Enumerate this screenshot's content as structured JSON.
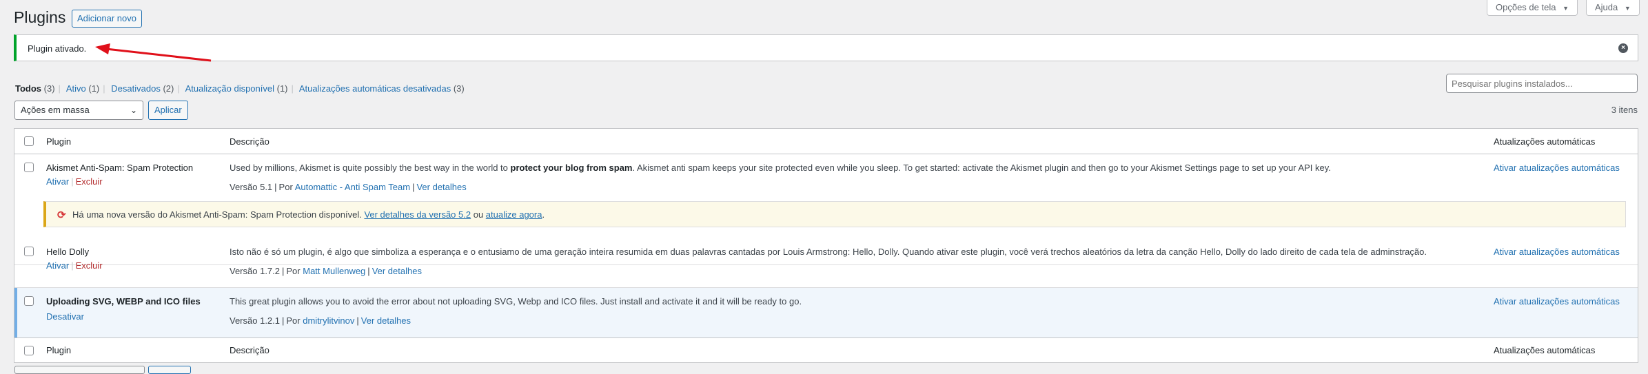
{
  "header": {
    "title": "Plugins",
    "add_new": "Adicionar novo",
    "screen_options": "Opções de tela",
    "help": "Ajuda"
  },
  "notice": {
    "text": "Plugin ativado."
  },
  "filters": [
    {
      "label": "Todos",
      "count": "(3)"
    },
    {
      "label": "Ativo",
      "count": "(1)"
    },
    {
      "label": "Desativados",
      "count": "(2)"
    },
    {
      "label": "Atualização disponível",
      "count": "(1)"
    },
    {
      "label": "Atualizações automáticas desativadas",
      "count": "(3)"
    }
  ],
  "search": {
    "placeholder": "Pesquisar plugins instalados..."
  },
  "bulk": {
    "selected": "Ações em massa",
    "apply": "Aplicar"
  },
  "items_count": "3 itens",
  "table": {
    "columns": {
      "plugin": "Plugin",
      "description": "Descrição",
      "auto": "Atualizações automáticas"
    },
    "sep": "|",
    "rows": [
      {
        "name": "Akismet Anti-Spam: Spam Protection",
        "action_1": "Ativar",
        "action_2": "Excluir",
        "desc_before": "Used by millions, Akismet is quite possibly the best way in the world to ",
        "desc_bold": "protect your blog from spam",
        "desc_after": ". Akismet anti spam keeps your site protected even while you sleep. To get started: activate the Akismet plugin and then go to your Akismet Settings page to set up your API key.",
        "version": "Versão 5.1",
        "by": "Por",
        "author": "Automattic - Anti Spam Team",
        "details": "Ver detalhes",
        "auto": "Ativar atualizações automáticas"
      },
      {
        "name": "Hello Dolly",
        "action_1": "Ativar",
        "action_2": "Excluir",
        "desc": "Isto não é só um plugin, é algo que simboliza a esperança e o entusiamo de uma geração inteira resumida em duas palavras cantadas por Louis Armstrong: Hello, Dolly. Quando ativar este plugin, você verá trechos aleatórios da letra da canção Hello, Dolly do lado direito de cada tela de adminstração.",
        "version": "Versão 1.7.2",
        "by": "Por",
        "author": "Matt Mullenweg",
        "details": "Ver detalhes",
        "auto": "Ativar atualizações automáticas"
      },
      {
        "name": "Uploading SVG, WEBP and ICO files",
        "action_1": "Desativar",
        "desc": "This great plugin allows you to avoid the error about not uploading SVG, Webp and ICO files. Just install and activate it and it will be ready to go.",
        "version": "Versão 1.2.1",
        "by": "Por",
        "author": "dmitrylitvinov",
        "details": "Ver detalhes",
        "auto": "Ativar atualizações automáticas"
      }
    ],
    "update_notice": {
      "before": "Há uma nova versão do Akismet Anti-Spam: Spam Protection disponível. ",
      "link_1": "Ver detalhes da versão 5.2",
      "middle": " ou ",
      "link_2": "atualize agora",
      "after": "."
    }
  },
  "colors": {
    "accent": "#2271b1",
    "success": "#00a32a",
    "warning": "#dba617",
    "danger": "#b32d2e",
    "annotation_arrow": "#e0101a"
  }
}
